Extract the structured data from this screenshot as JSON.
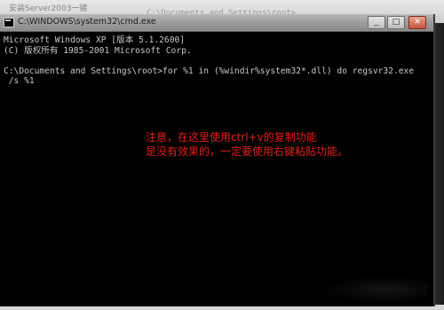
{
  "background": {
    "blurred_caption": "安装Server2003一键",
    "prompt_echo": "C:\\Documents and Settings\\root>_"
  },
  "window": {
    "title": "C:\\WINDOWS\\system32\\cmd.exe",
    "buttons": {
      "minimize": "_",
      "maximize": "□",
      "close": "✕"
    }
  },
  "console": {
    "lines": [
      "Microsoft Windows XP [版本 5.1.2600]",
      "(C) 版权所有 1985-2001 Microsoft Corp.",
      "",
      "C:\\Documents and Settings\\root>for %1 in (%windir%system32*.dll) do regsvr32.exe",
      " /s %1"
    ]
  },
  "annotation": {
    "line1": "注意，在这里使用ctrl+v的复制功能",
    "line2": "是没有效果的，一定要使用右键粘贴功能。"
  },
  "colors": {
    "console_bg": "#000000",
    "console_text": "#c8c8c8",
    "annotation": "#e0201a",
    "titlebar": "#a0a0a0"
  },
  "icons": {
    "window_icon": "cmd-icon"
  }
}
